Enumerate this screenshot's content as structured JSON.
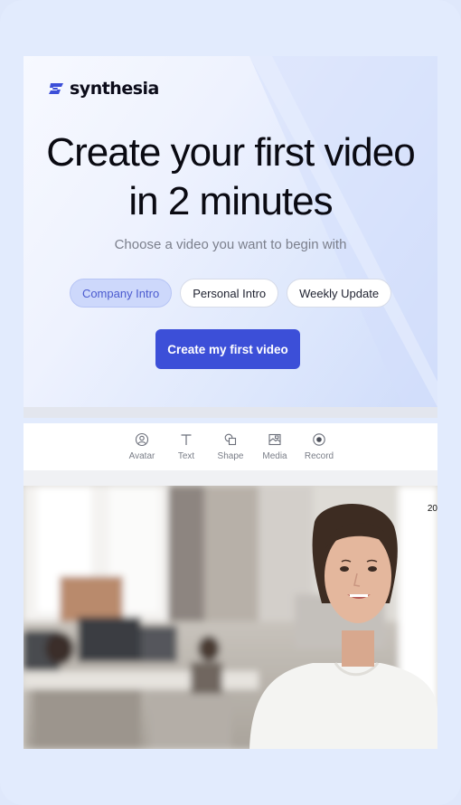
{
  "brand": {
    "name": "synthesia"
  },
  "hero": {
    "headline_line1": "Create your first video",
    "headline_line2": "in 2 minutes",
    "subtitle": "Choose a video you want to begin with",
    "options": [
      {
        "label": "Company Intro",
        "selected": true
      },
      {
        "label": "Personal Intro",
        "selected": false
      },
      {
        "label": "Weekly Update",
        "selected": false
      }
    ],
    "cta_label": "Create my first video"
  },
  "toolbar": {
    "items": [
      {
        "label": "Avatar",
        "icon": "avatar-icon"
      },
      {
        "label": "Text",
        "icon": "text-icon"
      },
      {
        "label": "Shape",
        "icon": "shape-icon"
      },
      {
        "label": "Media",
        "icon": "media-icon"
      },
      {
        "label": "Record",
        "icon": "record-icon"
      }
    ]
  },
  "canvas": {
    "corner_text": "20"
  },
  "colors": {
    "accent": "#3c4fd8",
    "chip_selected_bg": "#cdd8fb",
    "chip_selected_text": "#4b5bcf",
    "background": "#e2ebfd"
  }
}
